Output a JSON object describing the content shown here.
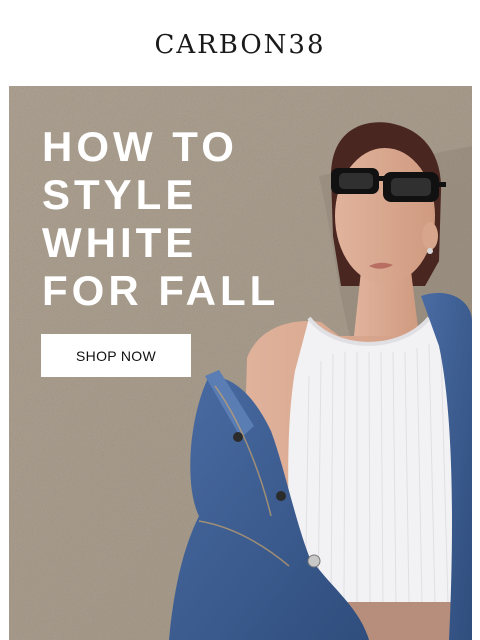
{
  "brand": {
    "logo_text": "CARBON38"
  },
  "hero": {
    "headline_lines": [
      "HOW TO",
      "STYLE",
      "WHITE",
      "FOR FALL"
    ],
    "cta_label": "SHOP NOW",
    "image_label": "Model wearing white ribbed tank, oversized denim jacket and black sunglasses against a concrete wall"
  },
  "colors": {
    "background": "#ffffff",
    "concrete": "#a69a8b",
    "denim": "#3e5f93",
    "tank": "#f3f3f5",
    "headline": "#ffffff",
    "button_bg": "#ffffff",
    "button_text": "#111111"
  }
}
